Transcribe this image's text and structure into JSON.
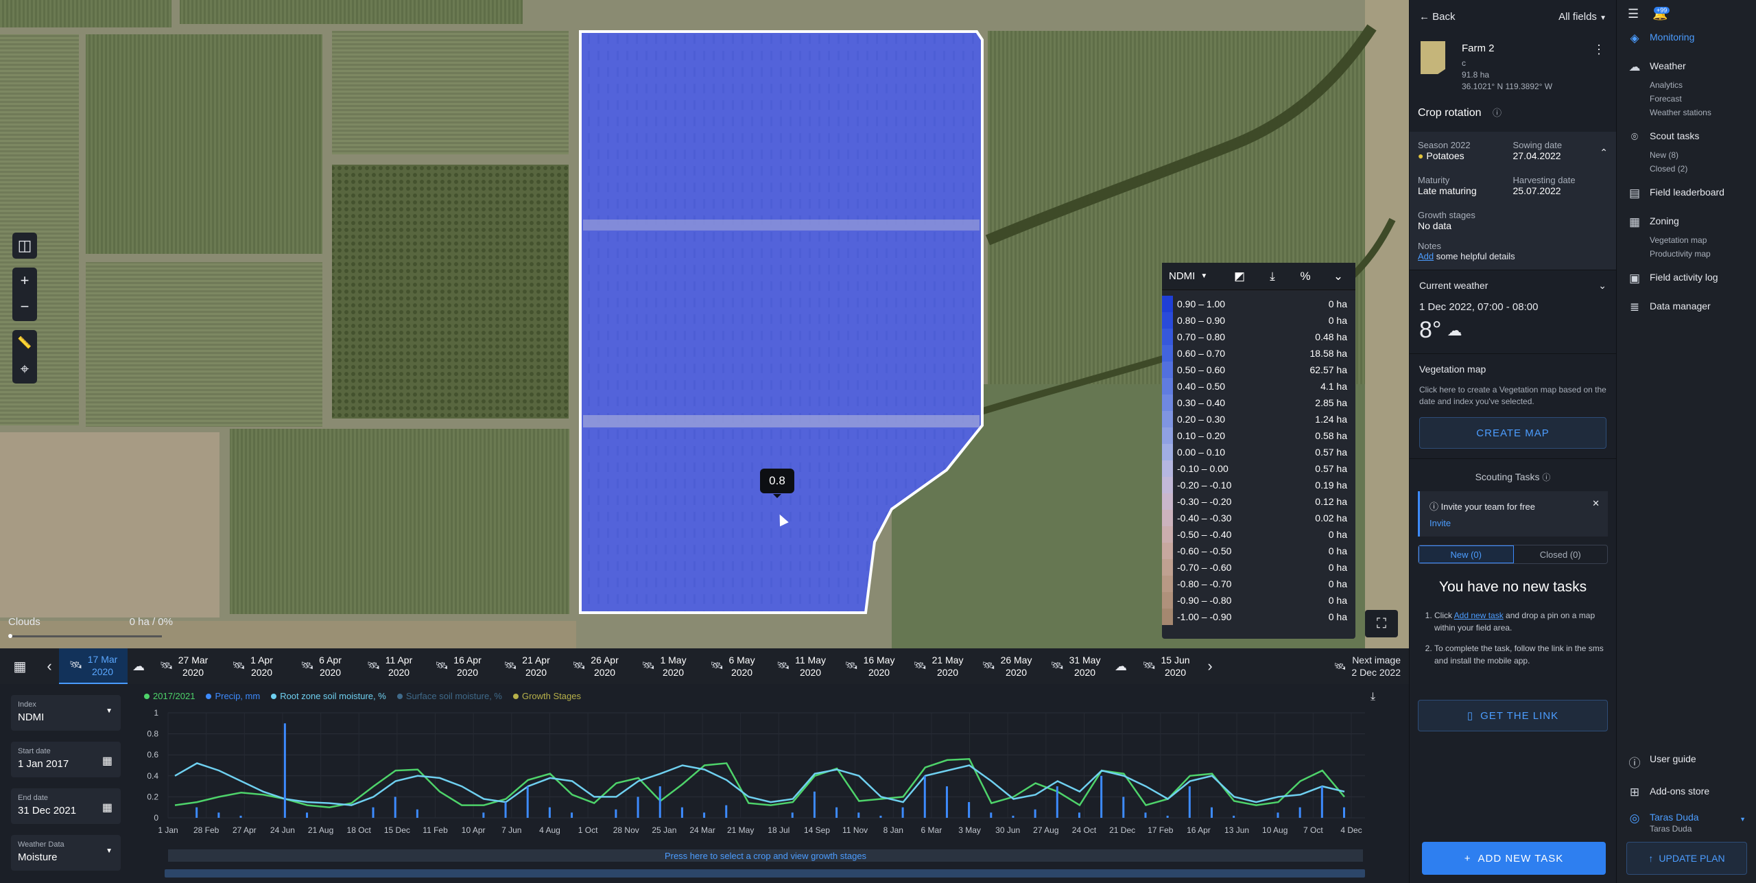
{
  "map": {
    "tooltip_value": "0.8",
    "clouds_label": "Clouds",
    "clouds_value": "0 ha / 0%",
    "tools": {
      "compare": "compare-icon",
      "zoom_in": "+",
      "zoom_out": "−"
    }
  },
  "legend": {
    "index": "NDMI",
    "rows": [
      {
        "range": "0.90 – 1.00",
        "value": "0 ha",
        "color": "#1f3fd6"
      },
      {
        "range": "0.80 – 0.90",
        "value": "0 ha",
        "color": "#2a4bda"
      },
      {
        "range": "0.70 – 0.80",
        "value": "0.48 ha",
        "color": "#3658dc"
      },
      {
        "range": "0.60 – 0.70",
        "value": "18.58 ha",
        "color": "#4264de"
      },
      {
        "range": "0.50 – 0.60",
        "value": "62.57 ha",
        "color": "#5270df"
      },
      {
        "range": "0.40 – 0.50",
        "value": "4.1 ha",
        "color": "#607ce0"
      },
      {
        "range": "0.30 – 0.40",
        "value": "2.85 ha",
        "color": "#6f88e1"
      },
      {
        "range": "0.20 – 0.30",
        "value": "1.24 ha",
        "color": "#7f95e2"
      },
      {
        "range": "0.10 – 0.20",
        "value": "0.58 ha",
        "color": "#8fa1e3"
      },
      {
        "range": "0.00 – 0.10",
        "value": "0.57 ha",
        "color": "#a0aee4"
      },
      {
        "range": "-0.10 – 0.00",
        "value": "0.57 ha",
        "color": "#b5b7e0"
      },
      {
        "range": "-0.20 – -0.10",
        "value": "0.19 ha",
        "color": "#c2b9d8"
      },
      {
        "range": "-0.30 – -0.20",
        "value": "0.12 ha",
        "color": "#c9b7cc"
      },
      {
        "range": "-0.40 – -0.30",
        "value": "0.02 ha",
        "color": "#ccb3bd"
      },
      {
        "range": "-0.50 – -0.40",
        "value": "0 ha",
        "color": "#cbaeae"
      },
      {
        "range": "-0.60 – -0.50",
        "value": "0 ha",
        "color": "#c7a89f"
      },
      {
        "range": "-0.70 – -0.60",
        "value": "0 ha",
        "color": "#c0a191"
      },
      {
        "range": "-0.80 – -0.70",
        "value": "0 ha",
        "color": "#b89985"
      },
      {
        "range": "-0.90 – -0.80",
        "value": "0 ha",
        "color": "#af917b"
      },
      {
        "range": "-1.00 – -0.90",
        "value": "0 ha",
        "color": "#a58870"
      }
    ]
  },
  "timeline": {
    "dates": [
      {
        "d": "17 Mar",
        "y": "2020",
        "active": true
      },
      {
        "d": "27 Mar",
        "y": "2020"
      },
      {
        "d": "1 Apr",
        "y": "2020"
      },
      {
        "d": "6 Apr",
        "y": "2020"
      },
      {
        "d": "11 Apr",
        "y": "2020"
      },
      {
        "d": "16 Apr",
        "y": "2020"
      },
      {
        "d": "21 Apr",
        "y": "2020"
      },
      {
        "d": "26 Apr",
        "y": "2020"
      },
      {
        "d": "1 May",
        "y": "2020"
      },
      {
        "d": "6 May",
        "y": "2020"
      },
      {
        "d": "11 May",
        "y": "2020"
      },
      {
        "d": "16 May",
        "y": "2020"
      },
      {
        "d": "21 May",
        "y": "2020"
      },
      {
        "d": "26 May",
        "y": "2020"
      },
      {
        "d": "31 May",
        "y": "2020"
      },
      {
        "d": "15 Jun",
        "y": "2020"
      }
    ],
    "next_label": "Next image",
    "next_date": "2 Dec 2022"
  },
  "controls": {
    "index_label": "Index",
    "index_value": "NDMI",
    "start_label": "Start date",
    "start_value": "1 Jan 2017",
    "end_label": "End date",
    "end_value": "31 Dec 2021",
    "weather_label": "Weather Data",
    "weather_value": "Moisture"
  },
  "chart_legend": [
    {
      "name": "2017/2021",
      "color": "#4ed36a"
    },
    {
      "name": "Precip, mm",
      "color": "#3d8bff"
    },
    {
      "name": "Root zone soil moisture, %",
      "color": "#6fd0f0"
    },
    {
      "name": "Surface soil moisture, %",
      "color": "#3f6a8a"
    },
    {
      "name": "Growth Stages",
      "color": "#b7b14a"
    }
  ],
  "chart_data": {
    "type": "line",
    "title": "",
    "ylim": [
      0,
      1
    ],
    "yticks": [
      "1",
      "0.8",
      "0.6",
      "0.4",
      "0.2",
      "0"
    ],
    "xticks": [
      "1 Jan",
      "28 Feb",
      "27 Apr",
      "24 Jun",
      "21 Aug",
      "18 Oct",
      "15 Dec",
      "11 Feb",
      "10 Apr",
      "7 Jun",
      "4 Aug",
      "1 Oct",
      "28 Nov",
      "25 Jan",
      "24 Mar",
      "21 May",
      "18 Jul",
      "14 Sep",
      "11 Nov",
      "8 Jan",
      "6 Mar",
      "3 May",
      "30 Jun",
      "27 Aug",
      "24 Oct",
      "21 Dec",
      "17 Feb",
      "16 Apr",
      "13 Jun",
      "10 Aug",
      "7 Oct",
      "4 Dec"
    ],
    "series": [
      {
        "name": "2017/2021",
        "values": [
          0.12,
          0.15,
          0.2,
          0.24,
          0.22,
          0.18,
          0.12,
          0.1,
          0.14,
          0.3,
          0.45,
          0.46,
          0.25,
          0.12,
          0.12,
          0.18,
          0.36,
          0.42,
          0.22,
          0.14,
          0.33,
          0.38,
          0.16,
          0.32,
          0.5,
          0.52,
          0.14,
          0.12,
          0.15,
          0.4,
          0.47,
          0.16,
          0.18,
          0.2,
          0.48,
          0.55,
          0.56,
          0.14,
          0.2,
          0.33,
          0.25,
          0.12,
          0.45,
          0.42,
          0.12,
          0.18,
          0.4,
          0.42,
          0.16,
          0.12,
          0.15,
          0.35,
          0.45,
          0.2
        ]
      },
      {
        "name": "Root zone soil moisture, %",
        "values": [
          0.4,
          0.52,
          0.45,
          0.35,
          0.25,
          0.18,
          0.15,
          0.14,
          0.12,
          0.2,
          0.35,
          0.4,
          0.38,
          0.3,
          0.18,
          0.15,
          0.3,
          0.38,
          0.35,
          0.2,
          0.2,
          0.35,
          0.42,
          0.5,
          0.46,
          0.36,
          0.2,
          0.15,
          0.18,
          0.42,
          0.46,
          0.4,
          0.2,
          0.15,
          0.4,
          0.45,
          0.5,
          0.35,
          0.18,
          0.22,
          0.35,
          0.25,
          0.45,
          0.4,
          0.3,
          0.18,
          0.35,
          0.4,
          0.2,
          0.15,
          0.2,
          0.22,
          0.3,
          0.25
        ]
      },
      {
        "name": "Precip, mm",
        "values": [
          0.0,
          0.1,
          0.05,
          0.02,
          0.0,
          0.9,
          0.05,
          0.0,
          0.0,
          0.1,
          0.2,
          0.08,
          0.0,
          0.0,
          0.05,
          0.15,
          0.3,
          0.1,
          0.05,
          0.0,
          0.08,
          0.2,
          0.3,
          0.1,
          0.05,
          0.12,
          0.0,
          0.0,
          0.05,
          0.25,
          0.1,
          0.05,
          0.02,
          0.1,
          0.4,
          0.3,
          0.15,
          0.05,
          0.02,
          0.08,
          0.3,
          0.05,
          0.4,
          0.2,
          0.05,
          0.02,
          0.3,
          0.1,
          0.02,
          0.0,
          0.05,
          0.1,
          0.3,
          0.1
        ]
      }
    ]
  },
  "chart_ui": {
    "crop_strip": "Press here to select a crop and view growth stages"
  },
  "fieldpanel": {
    "back": "Back",
    "all_fields": "All fields",
    "farm_name": "Farm 2",
    "farm_c": "c",
    "farm_area": "91.8 ha",
    "farm_coords": "36.1021° N 119.3892° W",
    "crop_rotation": "Crop rotation",
    "season": "Season 2022",
    "crop": "Potatoes",
    "sowing_label": "Sowing date",
    "sowing_value": "27.04.2022",
    "maturity_label": "Maturity",
    "maturity_value": "Late maturing",
    "harvest_label": "Harvesting date",
    "harvest_value": "25.07.2022",
    "growth_label": "Growth stages",
    "growth_value": "No data",
    "notes_label": "Notes",
    "notes_add": "Add",
    "notes_rest": " some helpful details",
    "current_weather": "Current weather",
    "weather_time": "1 Dec 2022, 07:00 - 08:00",
    "temp": "8°",
    "vegmap_title": "Vegetation map",
    "vegmap_text": "Click here to create a Vegetation map based on the date and index you've selected.",
    "create_map": "CREATE MAP",
    "scouting_title": "Scouting Tasks",
    "invite_text": "Invite your team for free",
    "invite_link": "Invite",
    "tab_new": "New (0)",
    "tab_closed": "Closed (0)",
    "no_tasks": "You have no new tasks",
    "step1_link": "Add new task",
    "step1_pre": "Click ",
    "step1_post": " and drop a pin on a map within your field area.",
    "step2": "To complete the task, follow the link in the sms and install the mobile app.",
    "get_link": "GET THE LINK",
    "add_task": "ADD NEW TASK"
  },
  "sidenav": {
    "badge": "+99",
    "items": [
      {
        "label": "Monitoring",
        "icon": "layers-icon",
        "sub": []
      },
      {
        "label": "Weather",
        "icon": "cloud-icon",
        "sub": [
          "Analytics",
          "Forecast",
          "Weather stations"
        ]
      },
      {
        "label": "Scout tasks",
        "icon": "pin-icon",
        "sub": [
          "New (8)",
          "Closed (2)"
        ]
      },
      {
        "label": "Field leaderboard",
        "icon": "chart-icon",
        "sub": []
      },
      {
        "label": "Zoning",
        "icon": "grid-icon",
        "sub": [
          "Vegetation map",
          "Productivity map"
        ]
      },
      {
        "label": "Field activity log",
        "icon": "calendar-icon",
        "sub": []
      },
      {
        "label": "Data manager",
        "icon": "stack-icon",
        "sub": []
      }
    ],
    "user_guide": "User guide",
    "addons": "Add-ons store",
    "user_name": "Taras Duda",
    "user_sub": "Taras Duda",
    "update_plan": "UPDATE PLAN"
  }
}
